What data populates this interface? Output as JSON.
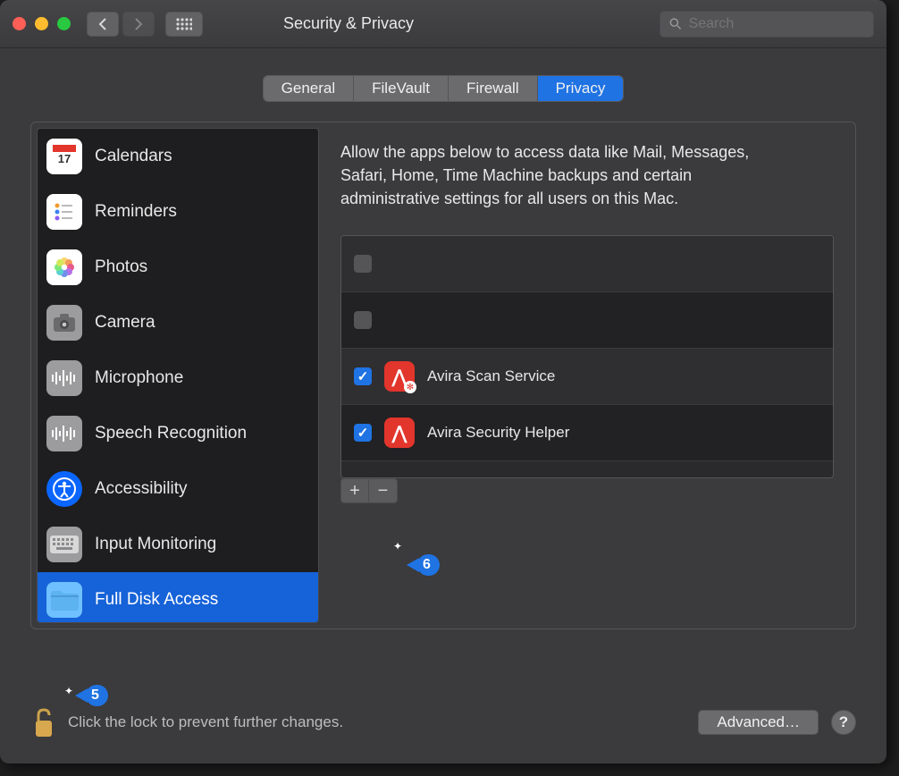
{
  "window": {
    "title": "Security & Privacy"
  },
  "search": {
    "placeholder": "Search"
  },
  "tabs": [
    {
      "label": "General",
      "active": false
    },
    {
      "label": "FileVault",
      "active": false
    },
    {
      "label": "Firewall",
      "active": false
    },
    {
      "label": "Privacy",
      "active": true
    }
  ],
  "sidebar": {
    "items": [
      {
        "label": "Calendars",
        "icon": "calendar"
      },
      {
        "label": "Reminders",
        "icon": "reminders"
      },
      {
        "label": "Photos",
        "icon": "photos"
      },
      {
        "label": "Camera",
        "icon": "camera"
      },
      {
        "label": "Microphone",
        "icon": "microphone"
      },
      {
        "label": "Speech Recognition",
        "icon": "speech"
      },
      {
        "label": "Accessibility",
        "icon": "accessibility"
      },
      {
        "label": "Input Monitoring",
        "icon": "input-monitoring"
      },
      {
        "label": "Full Disk Access",
        "icon": "full-disk-access",
        "selected": true
      }
    ]
  },
  "detail": {
    "description": "Allow the apps below to access data like Mail, Messages, Safari, Home, Time Machine backups and certain administrative settings for all users on this Mac.",
    "apps": [
      {
        "name": "",
        "checked": false,
        "hasIcon": false
      },
      {
        "name": "",
        "checked": false,
        "hasIcon": false
      },
      {
        "name": "Avira Scan Service",
        "checked": true,
        "hasIcon": true,
        "gear": true
      },
      {
        "name": "Avira Security Helper",
        "checked": true,
        "hasIcon": true,
        "gear": false
      }
    ]
  },
  "footer": {
    "lock_text": "Click the lock to prevent further changes.",
    "advanced_label": "Advanced…"
  },
  "callouts": {
    "five": "5",
    "six": "6"
  }
}
